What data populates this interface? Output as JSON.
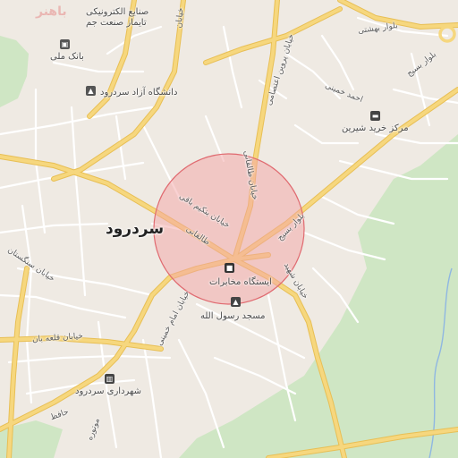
{
  "map": {
    "city_name": "سردرود",
    "watermark": "باهنر",
    "colors": {
      "background": "#efeae3",
      "block_outline": "#e0dad2",
      "green_area": "#cfe6c4",
      "major_road": "#f6d77e",
      "major_road_casing": "#e8bf55",
      "minor_road": "#ffffff",
      "highlight_fill": "#f4a3a6",
      "highlight_stroke": "#e06a70",
      "water": "#8fb7e2"
    },
    "pois": [
      {
        "name": "صنایع الکترونیکی",
        "icon": "factory-icon"
      },
      {
        "name": "تایماز صنعت جم",
        "icon": ""
      },
      {
        "name": "بانک ملی",
        "icon": "bank-icon"
      },
      {
        "name": "دانشگاه آزاد سردرود",
        "icon": "university-icon"
      },
      {
        "name": "مرکز خرید شیرین",
        "icon": "shopping-icon"
      },
      {
        "name": "ایستگاه مخابرات",
        "icon": "bus-stop-icon"
      },
      {
        "name": "مسجد رسول الله",
        "icon": "mosque-icon"
      },
      {
        "name": "شهرداری سردرود",
        "icon": "municipality-icon"
      }
    ],
    "streets": [
      {
        "name": "بلوار بهشتی"
      },
      {
        "name": "بلوار بسیج"
      },
      {
        "name": "احمد خمینی"
      },
      {
        "name": "خیابان پروین اعتصامی"
      },
      {
        "name": "خیابان طالقانی"
      },
      {
        "name": "خیابان بنکیم باقی"
      },
      {
        "name": "طالقانی"
      },
      {
        "name": "بلوار بسیج"
      },
      {
        "name": "خیابان شهید"
      },
      {
        "name": "خیابان سنگستان"
      },
      {
        "name": "خیابان امام خمینی"
      },
      {
        "name": "خیابان قلعه بان"
      },
      {
        "name": "حافظ"
      },
      {
        "name": "موتوره"
      },
      {
        "name": "خیابان"
      }
    ]
  }
}
